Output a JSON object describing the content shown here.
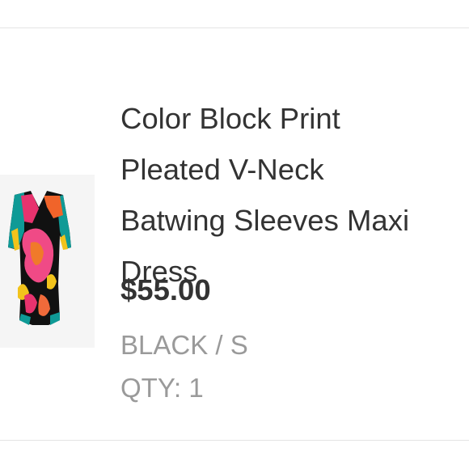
{
  "product": {
    "title_lines": [
      "Color Block Print",
      "Pleated V-Neck",
      "Batwing Sleeves Maxi",
      "Dress"
    ],
    "price": "$55.00",
    "variant": "BLACK / S",
    "quantity": "QTY: 1",
    "thumbnail_icon": "dress-product-image"
  },
  "colors": {
    "title_text": "#333333",
    "secondary_text": "#9a9a9a",
    "divider": "#e4e4e4",
    "thumb_bg": "#f5f5f5"
  }
}
